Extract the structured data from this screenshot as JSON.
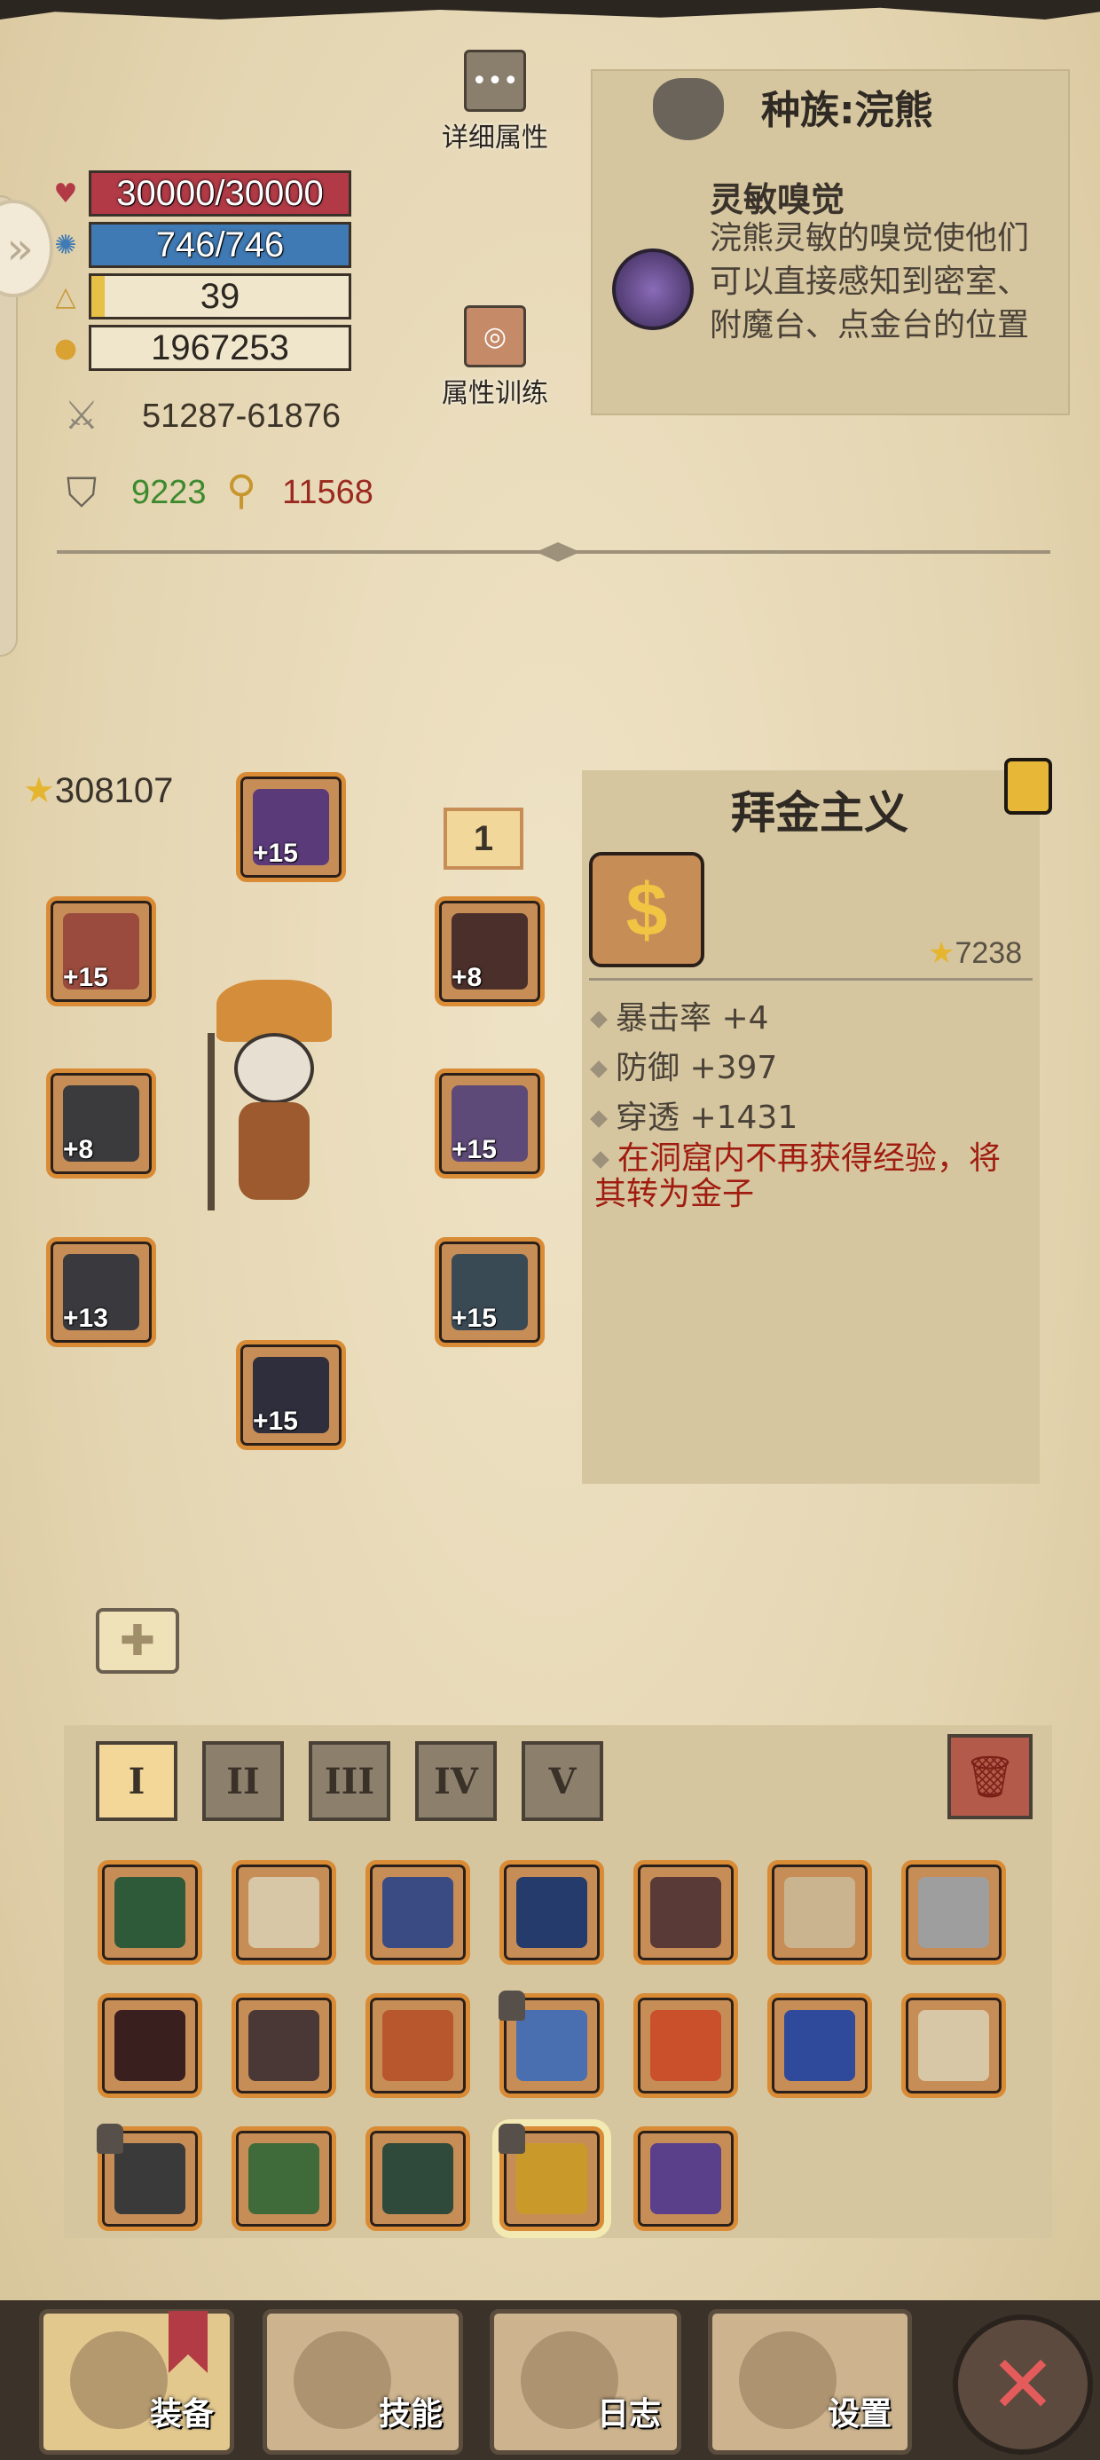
{
  "top": {
    "detail_attrs_label": "详细属性",
    "attr_training_label": "属性训练"
  },
  "stats": {
    "hp": "30000/30000",
    "mana": "746/746",
    "level": "39",
    "gold": "1967253",
    "attack": "51287-61876",
    "defense": "9223",
    "penetration": "11568",
    "hp_color": "#b13a46",
    "mana_color": "#3f7ab5",
    "level_fill_fraction": 0.05
  },
  "race": {
    "title": "种族:浣熊",
    "skill_name": "灵敏嗅觉",
    "skill_desc": "浣熊灵敏的嗅觉使他们可以直接感知到密室、附魔台、点金台的位置"
  },
  "character": {
    "score": "308107",
    "tier": "1",
    "slots": [
      {
        "id": "helmet",
        "plus": "+15",
        "color": "#5b3a7a"
      },
      {
        "id": "left-top",
        "plus": "+15",
        "color": "#9a4b3d"
      },
      {
        "id": "right-top",
        "plus": "+8",
        "color": "#4a2f2a"
      },
      {
        "id": "left-mid",
        "plus": "+8",
        "color": "#3b3a3d"
      },
      {
        "id": "right-mid",
        "plus": "+15",
        "color": "#5e4a78"
      },
      {
        "id": "left-bottom",
        "plus": "+13",
        "color": "#3a3a3e"
      },
      {
        "id": "right-bottom",
        "plus": "+15",
        "color": "#3a4a55"
      },
      {
        "id": "boots",
        "plus": "+15",
        "color": "#2f2e3c"
      }
    ]
  },
  "item": {
    "title": "拜金主义",
    "score": "7238",
    "stats": [
      "暴击率 +4",
      "防御 +397",
      "穿透 +1431"
    ],
    "special": "在洞窟内不再获得经验，将其转为金子"
  },
  "inventory": {
    "tabs": [
      "I",
      "II",
      "III",
      "IV",
      "V"
    ],
    "items": [
      {
        "color": "#2f5a3a",
        "locked": false
      },
      {
        "color": "#d8c7a6",
        "locked": false
      },
      {
        "color": "#3a4a82",
        "locked": false
      },
      {
        "color": "#243b6c",
        "locked": false
      },
      {
        "color": "#5a3a36",
        "locked": false
      },
      {
        "color": "#c9b48f",
        "locked": false
      },
      {
        "color": "#9e9e9e",
        "locked": false
      },
      {
        "color": "#3a1f1f",
        "locked": false
      },
      {
        "color": "#4a3836",
        "locked": false
      },
      {
        "color": "#b8562e",
        "locked": false
      },
      {
        "color": "#4a6fb0",
        "locked": true
      },
      {
        "color": "#c9502a",
        "locked": false
      },
      {
        "color": "#2f4a9a",
        "locked": false
      },
      {
        "color": "#d8c7a6",
        "locked": false
      },
      {
        "color": "#3a3a3a",
        "locked": true
      },
      {
        "color": "#3f6b3a",
        "locked": false
      },
      {
        "color": "#2f4a3a",
        "locked": false
      },
      {
        "color": "#c99a2a",
        "locked": true
      },
      {
        "color": "#5a3f8a",
        "locked": false
      }
    ]
  },
  "nav": {
    "equip": "装备",
    "skills": "技能",
    "log": "日志",
    "settings": "设置"
  }
}
